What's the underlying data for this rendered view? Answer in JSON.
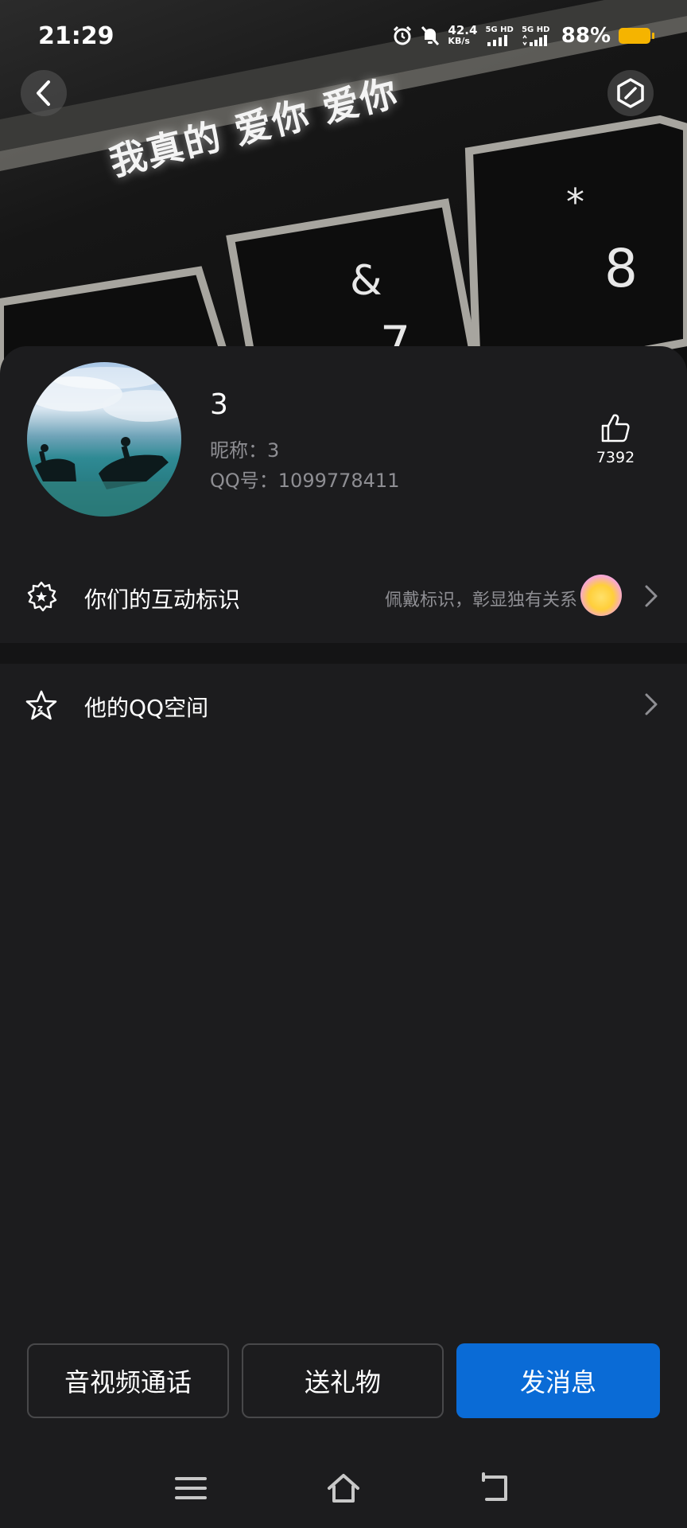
{
  "status_bar": {
    "time": "21:29",
    "net_speed_value": "42.4",
    "net_speed_unit": "KB/s",
    "sim1": "5G HD",
    "sim2": "5G HD",
    "battery": "88%"
  },
  "cover": {
    "text": "我真的 爱你 爱你",
    "keys": [
      "*",
      "8",
      "&",
      "7"
    ]
  },
  "profile": {
    "name": "3",
    "nickname_line": "昵称：3",
    "qq_line": "QQ号：1099778411",
    "like_count": "7392"
  },
  "rows": {
    "interaction": {
      "label": "你们的互动标识",
      "hint": "佩戴标识，彰显独有关系"
    },
    "qzone": {
      "label": "他的QQ空间"
    }
  },
  "actions": {
    "call": "音视频通话",
    "gift": "送礼物",
    "message": "发消息"
  },
  "colors": {
    "background": "#1c1c1e",
    "primary": "#0a6bd6",
    "secondary_text": "#8e8e93",
    "battery": "#f5b400"
  }
}
